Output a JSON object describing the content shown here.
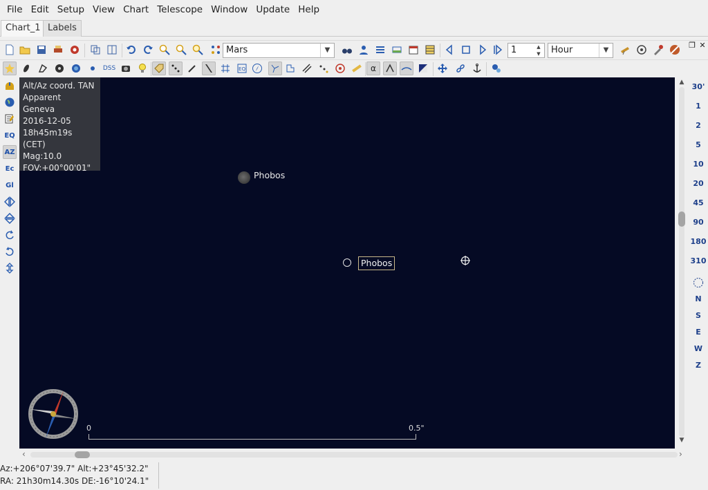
{
  "menu": [
    "File",
    "Edit",
    "Setup",
    "View",
    "Chart",
    "Telescope",
    "Window",
    "Update",
    "Help"
  ],
  "tabs": [
    {
      "label": "Chart_1",
      "active": true
    },
    {
      "label": "Labels",
      "active": false
    }
  ],
  "toolbar": {
    "object_search": "Mars",
    "step_value": "1",
    "time_unit": "Hour",
    "dss_label": "DSS",
    "alpha_label": "α"
  },
  "left_toolbar": {
    "eq": "EQ",
    "az": "AZ",
    "ec": "Ec",
    "gl": "Gl"
  },
  "info": {
    "line1": "Alt/Az coord. TAN",
    "line2": "Apparent",
    "line3": "Geneva",
    "line4": "2016-12-05",
    "line5": "18h45m19s (CET)",
    "line6": "Mag:10.0",
    "line7": "FOV:+00°00'01\""
  },
  "objects": {
    "planet_label": "Phobos",
    "marker_label": "Phobos"
  },
  "scale": {
    "start": "0",
    "end": "0.5\""
  },
  "fov_buttons": [
    "30'",
    "1",
    "2",
    "5",
    "10",
    "20",
    "45",
    "90",
    "180",
    "310"
  ],
  "direction_buttons": [
    "N",
    "S",
    "E",
    "W",
    "Z"
  ],
  "status": {
    "azalt": "Az:+206°07'39.7\" Alt:+23°45'32.2\"",
    "radec": "RA: 21h30m14.30s DE:-16°10'24.1\""
  },
  "colors": {
    "sky": "#050a24",
    "accent": "#1d4fa8"
  }
}
